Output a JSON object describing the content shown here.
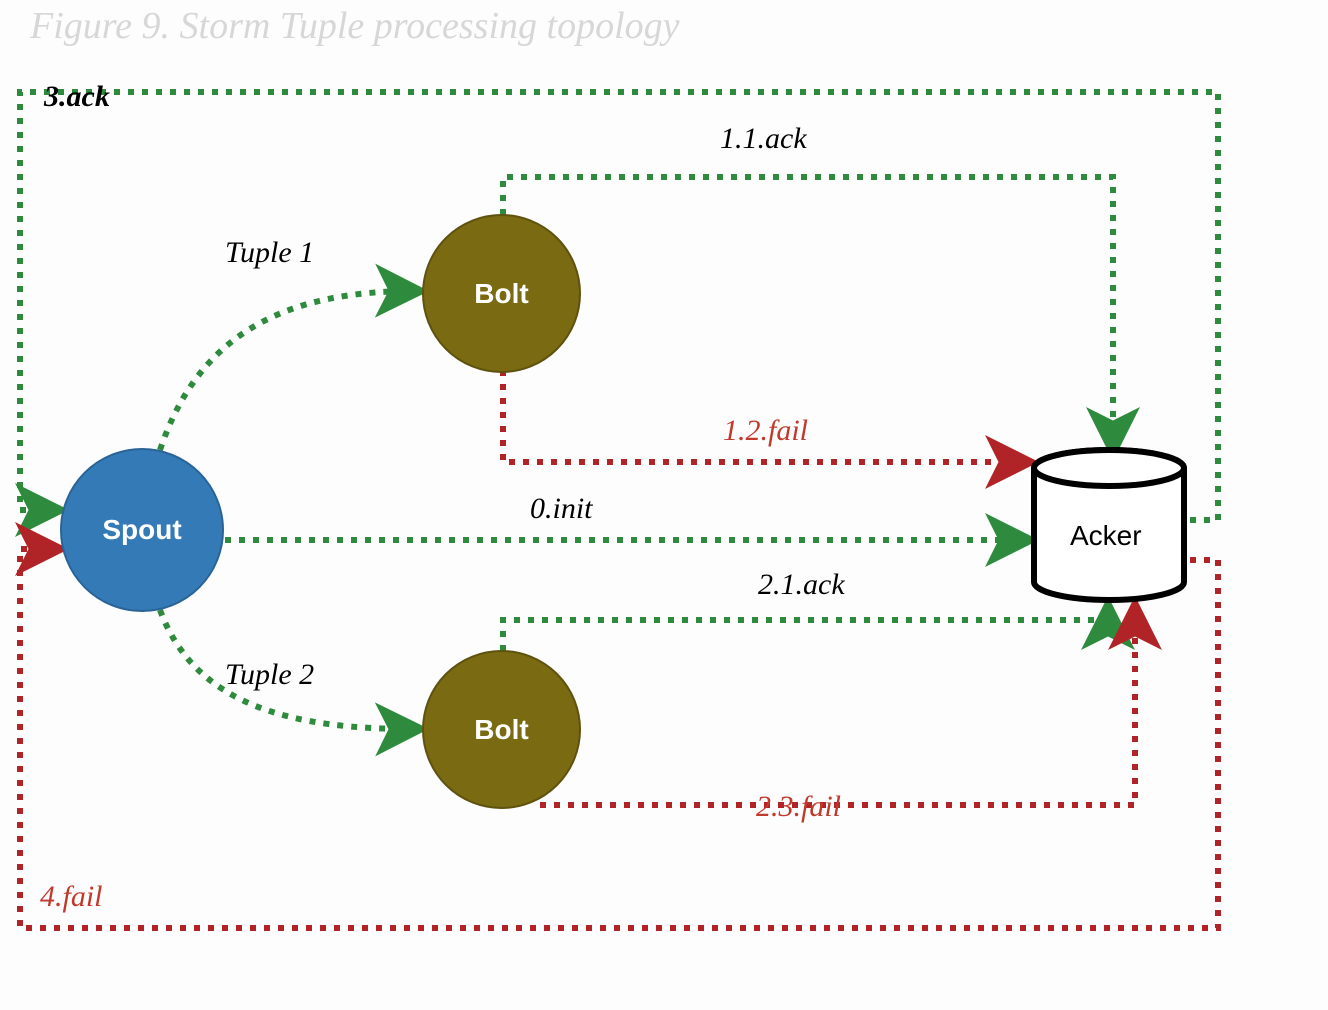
{
  "title": "Figure 9. Storm Tuple processing topology",
  "nodes": {
    "spout": "Spout",
    "bolt1": "Bolt",
    "bolt2": "Bolt",
    "acker": "Acker"
  },
  "edges": {
    "tuple1": "Tuple 1",
    "tuple2": "Tuple 2",
    "init": "0.init",
    "ack11": "1.1.ack",
    "fail12": "1.2.fail",
    "ack21": "2.1.ack",
    "fail23": "2.3.fail",
    "ack3": "3.ack",
    "fail4": "4.fail"
  },
  "colors": {
    "green": "#2e8b3d",
    "red": "#b02428",
    "spout": "#337ab7",
    "bolt": "#7a6a12",
    "title": "#d7d7d7"
  }
}
